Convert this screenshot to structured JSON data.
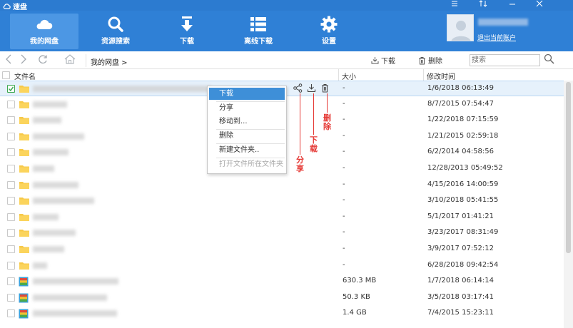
{
  "app": {
    "title": "速盘",
    "window_controls": [
      "menu-icon",
      "swap-icon",
      "minimize-icon",
      "close-icon"
    ]
  },
  "toolbar": {
    "items": [
      {
        "label": "我的网盘",
        "icon": "cloud-icon",
        "active": true
      },
      {
        "label": "资源搜索",
        "icon": "search-icon",
        "active": false
      },
      {
        "label": "下载",
        "icon": "download-icon",
        "active": false
      },
      {
        "label": "离线下载",
        "icon": "list-icon",
        "active": false
      },
      {
        "label": "设置",
        "icon": "gear-icon",
        "active": false
      }
    ],
    "logout": "退出当前账户"
  },
  "nav": {
    "breadcrumb": "我的网盘 >",
    "download": "下载",
    "delete": "删除",
    "search_placeholder": "搜索"
  },
  "table": {
    "headers": {
      "name": "文件名",
      "size": "大小",
      "mtime": "修改时间"
    },
    "rows": [
      {
        "type": "folder",
        "size": "-",
        "mtime": "1/6/2018 06:13:49",
        "checked": true,
        "selected": true
      },
      {
        "type": "folder",
        "size": "-",
        "mtime": "8/7/2015 07:54:47",
        "checked": false,
        "selected": false
      },
      {
        "type": "folder",
        "size": "-",
        "mtime": "1/22/2018 07:15:59",
        "checked": false,
        "selected": false
      },
      {
        "type": "folder",
        "size": "-",
        "mtime": "1/21/2015 02:59:18",
        "checked": false,
        "selected": false
      },
      {
        "type": "folder",
        "size": "-",
        "mtime": "6/2/2014 04:58:56",
        "checked": false,
        "selected": false
      },
      {
        "type": "folder",
        "size": "-",
        "mtime": "12/28/2013 05:49:52",
        "checked": false,
        "selected": false
      },
      {
        "type": "folder",
        "size": "-",
        "mtime": "4/15/2016 14:00:59",
        "checked": false,
        "selected": false
      },
      {
        "type": "folder",
        "size": "-",
        "mtime": "3/10/2018 05:41:55",
        "checked": false,
        "selected": false
      },
      {
        "type": "folder",
        "size": "-",
        "mtime": "5/1/2017 01:41:21",
        "checked": false,
        "selected": false
      },
      {
        "type": "folder",
        "size": "-",
        "mtime": "3/23/2017 08:31:49",
        "checked": false,
        "selected": false
      },
      {
        "type": "folder",
        "size": "-",
        "mtime": "3/9/2017 07:52:12",
        "checked": false,
        "selected": false
      },
      {
        "type": "folder",
        "size": "-",
        "mtime": "6/28/2018 09:42:54",
        "checked": false,
        "selected": false
      },
      {
        "type": "archive",
        "size": "630.3 MB",
        "mtime": "1/7/2018 06:14:14",
        "checked": false,
        "selected": false
      },
      {
        "type": "archive",
        "size": "50.3 KB",
        "mtime": "3/5/2018 03:17:41",
        "checked": false,
        "selected": false
      },
      {
        "type": "archive",
        "size": "1.4 GB",
        "mtime": "7/4/2015 15:23:11",
        "checked": false,
        "selected": false
      }
    ]
  },
  "context_menu": {
    "items": [
      {
        "label": "下载",
        "highlighted": true,
        "disabled": false
      },
      {
        "label": "分享",
        "highlighted": false,
        "disabled": false
      },
      {
        "label": "移动到...",
        "highlighted": false,
        "disabled": false
      },
      {
        "label": "删除",
        "highlighted": false,
        "disabled": false
      },
      {
        "label": "新建文件夹..",
        "highlighted": false,
        "disabled": false
      },
      {
        "label": "打开文件所在文件夹",
        "highlighted": false,
        "disabled": true
      }
    ]
  },
  "annotations": {
    "share": "分享",
    "download": "下载",
    "delete": "删除"
  },
  "colors": {
    "toolbar_bg": "#2f80d6",
    "accent": "#3e8fd8",
    "annotation": "#e53935",
    "folder": "#f7c948"
  }
}
